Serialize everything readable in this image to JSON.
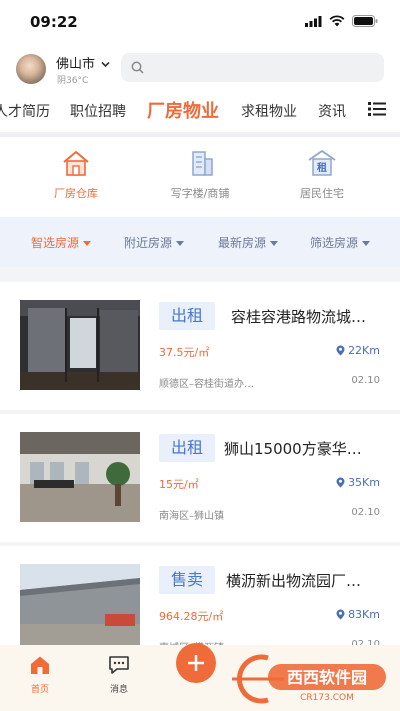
{
  "status_bar": {
    "time": "09:22"
  },
  "header": {
    "city": "佛山市",
    "weather": "阴36°C",
    "search_placeholder": ""
  },
  "tabs": [
    {
      "label": "人才简历"
    },
    {
      "label": "职位招聘"
    },
    {
      "label": "厂房物业",
      "active": true
    },
    {
      "label": "求租物业"
    },
    {
      "label": "资讯"
    }
  ],
  "categories": [
    {
      "label": "厂房仓库",
      "icon": "factory-icon",
      "active": true
    },
    {
      "label": "写字楼/商铺",
      "icon": "office-building-icon"
    },
    {
      "label": "居民住宅",
      "icon": "rental-home-icon",
      "icon_text": "租"
    }
  ],
  "filters": [
    {
      "label": "智选房源",
      "active": true
    },
    {
      "label": "附近房源"
    },
    {
      "label": "最新房源"
    },
    {
      "label": "筛选房源"
    }
  ],
  "listings": [
    {
      "badge": "出租",
      "title": "容桂容港路物流城…",
      "price": "37.5元/㎡",
      "distance": "22Km",
      "address": "顺德区–容桂街道办…",
      "date": "02.10"
    },
    {
      "badge": "出租",
      "title": "狮山15000方豪华…",
      "price": "15元/㎡",
      "distance": "35Km",
      "address": "南海区–狮山镇",
      "date": "02.10"
    },
    {
      "badge": "售卖",
      "title": "横沥新出物流园厂…",
      "price": "964.28元/㎡",
      "distance": "83Km",
      "address": "惠城区–横沥镇",
      "date": "02.10"
    }
  ],
  "bottom_nav": [
    {
      "label": "首页",
      "icon": "home-icon",
      "active": true
    },
    {
      "label": "消息",
      "icon": "message-icon"
    },
    {
      "label": "",
      "icon": "plus-icon"
    }
  ],
  "watermark": {
    "text": "西西软件园",
    "url_text": "CR173.COM"
  },
  "colors": {
    "accent": "#ef6b3a",
    "blue": "#4a78c8",
    "filter_bg": "#eef2fb"
  }
}
